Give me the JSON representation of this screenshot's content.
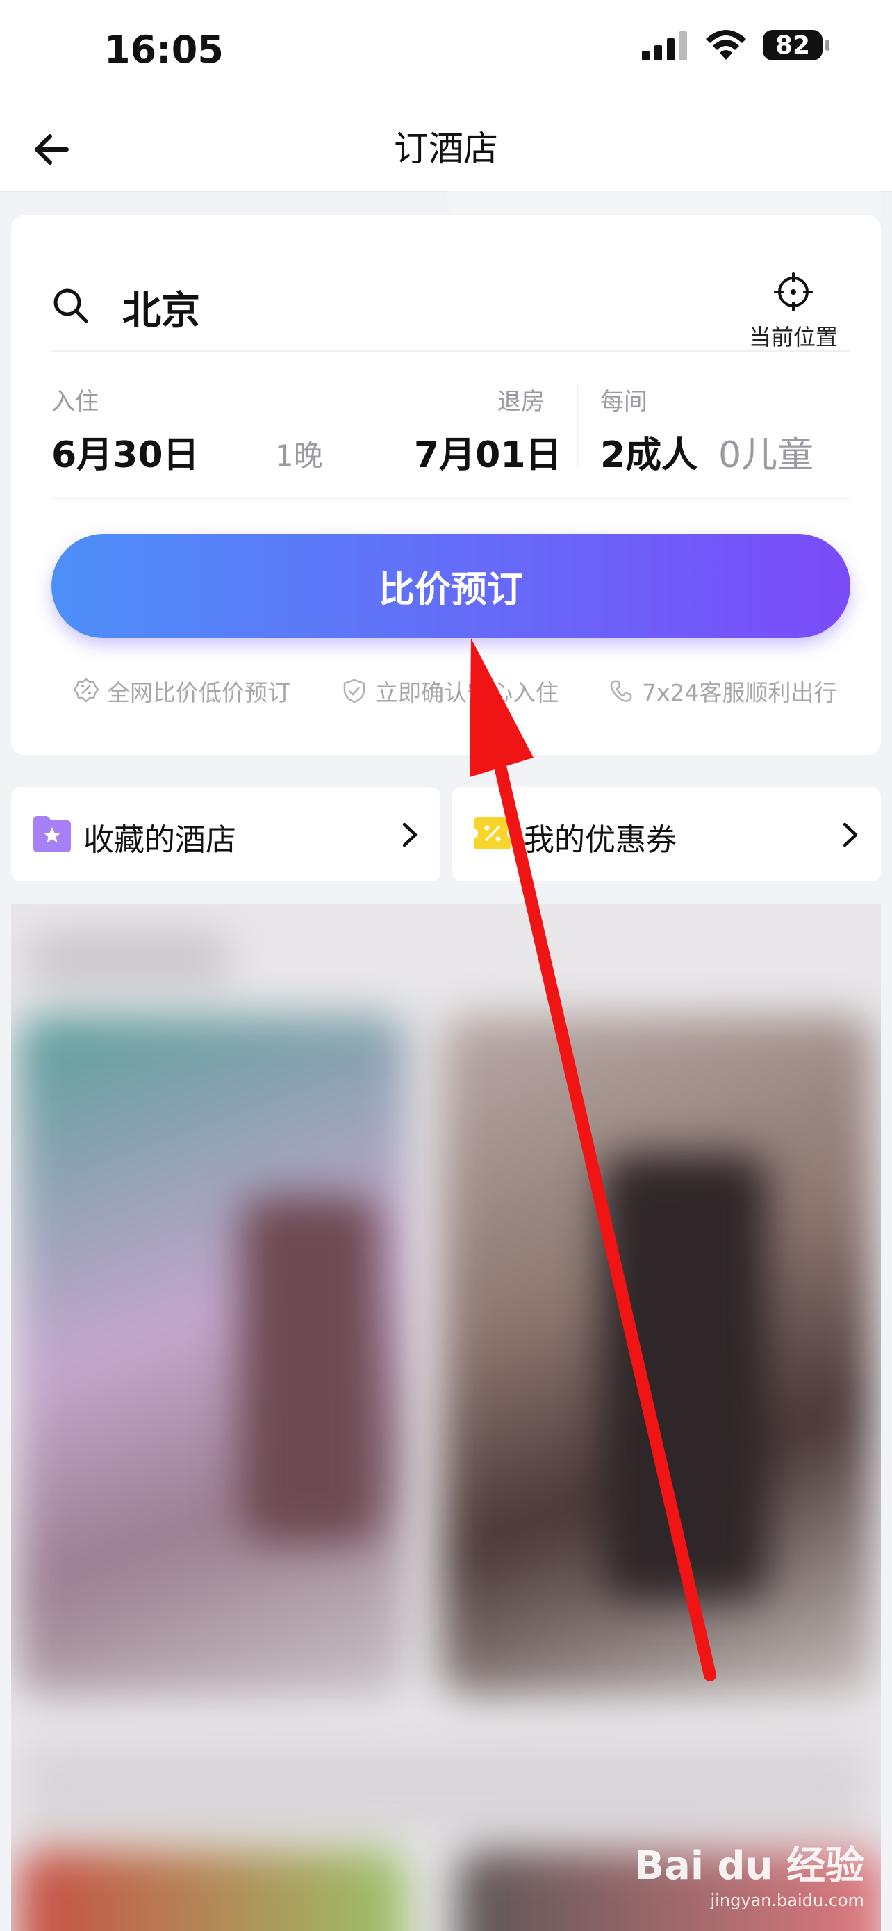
{
  "status_bar": {
    "time": "16:05",
    "battery": "82"
  },
  "nav": {
    "title": "订酒店"
  },
  "search": {
    "city": "北京",
    "location_label": "当前位置"
  },
  "dates": {
    "checkin_label": "入住",
    "checkin_value": "6月30日",
    "nights": "1晚",
    "checkout_label": "退房",
    "checkout_value": "7月01日",
    "room_label": "每间",
    "adults": "2成人",
    "children": "0儿童"
  },
  "book_button": "比价预订",
  "features": [
    {
      "label": "全网比价低价预订",
      "icon": "percent-badge-icon"
    },
    {
      "label": "立即确认安心入住",
      "icon": "shield-check-icon"
    },
    {
      "label": "7x24客服顺利出行",
      "icon": "phone-icon"
    }
  ],
  "quick_links": {
    "favorites": "收藏的酒店",
    "coupons": "我的优惠券"
  },
  "watermark": {
    "main": "Bai du 经验",
    "sub": "jingyan.baidu.com"
  },
  "colors": {
    "accent_start": "#4d8ff8",
    "accent_end": "#7a4cf8",
    "annotation_arrow": "#f01414"
  }
}
